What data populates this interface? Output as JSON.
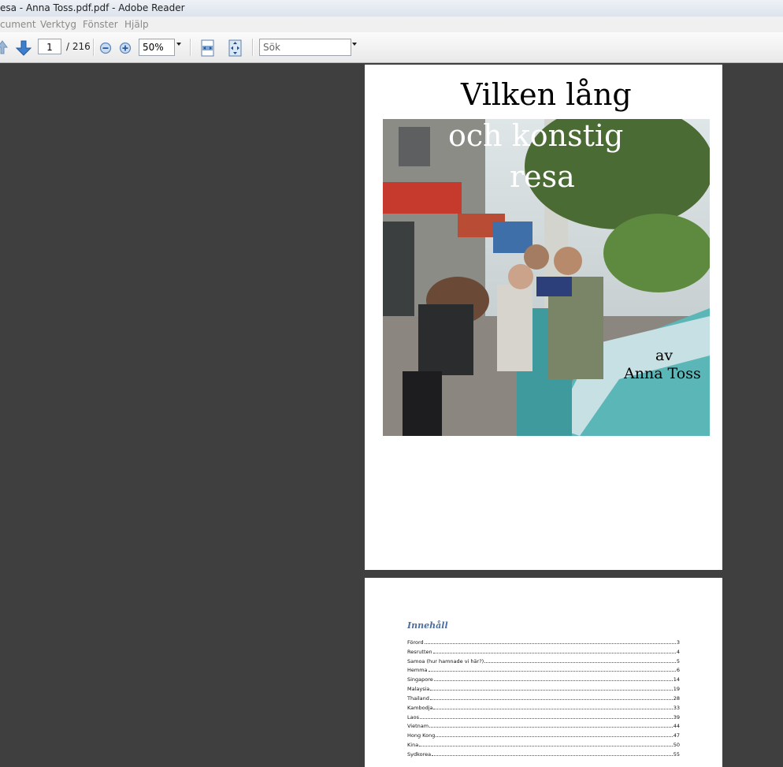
{
  "window": {
    "title": "esa - Anna Toss.pdf.pdf - Adobe Reader"
  },
  "menu": [
    "cument",
    "Verktyg",
    "Fönster",
    "Hjälp"
  ],
  "toolbar": {
    "page_current": "1",
    "page_total": "/ 216",
    "zoom": "50%",
    "search_placeholder": "Sök"
  },
  "cover": {
    "title_line1": "Vilken lång",
    "title_line2": "och konstig",
    "title_line3": "resa",
    "by": "av",
    "author": "Anna Toss"
  },
  "toc": {
    "heading": "Innehåll",
    "entries": [
      {
        "title": "Förord",
        "page": "3"
      },
      {
        "title": "Resrutten",
        "page": "4"
      },
      {
        "title": "Samoa (hur hamnade vi här?)",
        "page": "5"
      },
      {
        "title": "Hemma",
        "page": "6"
      },
      {
        "title": "Singapore",
        "page": "14"
      },
      {
        "title": "Malaysia",
        "page": "19"
      },
      {
        "title": "Thailand",
        "page": "28"
      },
      {
        "title": "Kambodja",
        "page": "33"
      },
      {
        "title": "Laos",
        "page": "39"
      },
      {
        "title": "Vietnam",
        "page": "44"
      },
      {
        "title": "Hong Kong",
        "page": "47"
      },
      {
        "title": "Kina",
        "page": "50"
      },
      {
        "title": "Sydkorea",
        "page": "55"
      }
    ]
  },
  "colors": {
    "viewer_bg": "#3f3f3f",
    "toc_heading": "#4f6ea0"
  }
}
